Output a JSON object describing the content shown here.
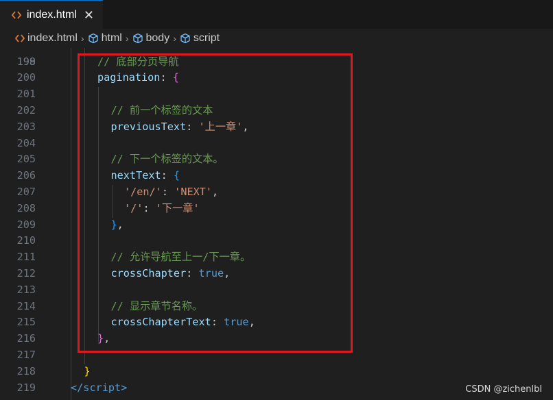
{
  "tab": {
    "title": "index.html",
    "close_glyph": "✕",
    "icon": "html-file-icon"
  },
  "breadcrumb": {
    "items": [
      {
        "label": "index.html",
        "icon": "html-file-icon"
      },
      {
        "label": "html",
        "icon": "element-cube-icon"
      },
      {
        "label": "body",
        "icon": "element-cube-icon"
      },
      {
        "label": "script",
        "icon": "element-cube-icon"
      }
    ],
    "separator": "›"
  },
  "editor": {
    "partial_line_number": "198",
    "lines": [
      {
        "n": "199",
        "comment": "// 底部分页导航"
      },
      {
        "n": "200",
        "prop": "pagination",
        "colon": ": ",
        "brace": "{"
      },
      {
        "n": "201"
      },
      {
        "n": "202",
        "comment": "// 前一个标签的文本"
      },
      {
        "n": "203",
        "prop": "previousText",
        "colon": ": ",
        "str": "'上一章'",
        "tail": ","
      },
      {
        "n": "204"
      },
      {
        "n": "205",
        "comment": "// 下一个标签的文本。"
      },
      {
        "n": "206",
        "prop": "nextText",
        "colon": ": ",
        "brace": "{"
      },
      {
        "n": "207",
        "key": "'/en/'",
        "colon": ": ",
        "str": "'NEXT'",
        "tail": ","
      },
      {
        "n": "208",
        "key": "'/'",
        "colon": ": ",
        "str": "'下一章'"
      },
      {
        "n": "209",
        "brace": "}",
        "tail": ","
      },
      {
        "n": "210"
      },
      {
        "n": "211",
        "comment": "// 允许导航至上一/下一章。"
      },
      {
        "n": "212",
        "prop": "crossChapter",
        "colon": ": ",
        "kw": "true",
        "tail": ","
      },
      {
        "n": "213"
      },
      {
        "n": "214",
        "comment": "// 显示章节名称。"
      },
      {
        "n": "215",
        "prop": "crossChapterText",
        "colon": ": ",
        "kw": "true",
        "tail": ","
      },
      {
        "n": "216",
        "brace": "}",
        "tail": ","
      },
      {
        "n": "217"
      },
      {
        "n": "218",
        "brace": "}"
      },
      {
        "n": "219",
        "tag_open": "</",
        "tag_name": "script",
        "tag_close": ">"
      }
    ]
  },
  "watermark": "CSDN @zichenlbl",
  "colors": {
    "highlight_box": "#e0191f",
    "comment": "#6a9955",
    "property": "#9cdcfe",
    "string": "#ce9178",
    "keyword": "#569cd6"
  }
}
